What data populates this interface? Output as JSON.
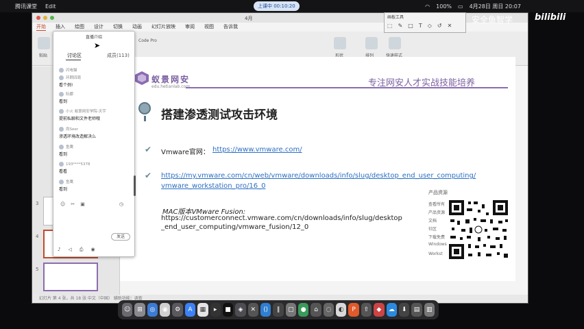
{
  "menubar": {
    "app_name": "腾讯课堂",
    "edit": "Edit",
    "recording": "上课中 00:10:20",
    "time": "4月28日 周日 20:07",
    "battery": "100%"
  },
  "window": {
    "title": "4月",
    "tabs": [
      "开始",
      "插入",
      "绘图",
      "设计",
      "切换",
      "动画",
      "幻灯片放映",
      "审阅",
      "视图",
      "告诉我"
    ],
    "ribbon_labels": [
      "粘贴",
      "新建",
      "排列",
      "快速样式",
      "形状"
    ],
    "font_name": "Code Pro"
  },
  "thumbnails": [
    "3",
    "4",
    "5"
  ],
  "slide": {
    "logo_title": "蚁景网安",
    "logo_url": "edu.hetianlab.com",
    "slogan": "专注网安人才实战技能培养",
    "headline": "搭建渗透测试攻击环境",
    "vmware_label": "Vmware官网：",
    "vmware_link": "https://www.vmware.com/",
    "download_link_1": "https://my.vmware.com/cn/web/vmware/downloads/info/slug/desktop_end_user_computing/",
    "download_link_2": "vmware_workstation_pro/16_0",
    "mac_label": "MAC版本VMware Fusion:",
    "mac_link_1": "https://customerconnect.vmware.com/cn/downloads/info/slug/desktop",
    "mac_link_2": "_end_user_computing/vmware_fusion/12_0",
    "qr_head": "产品资源",
    "qr_side": [
      "查看所有",
      "产品资源",
      "文档",
      "社区",
      "下载免费",
      "Windows",
      "Workst"
    ]
  },
  "statusbar": {
    "text": "幻灯片 第 4 张，共 18 张     中文（中国）    辅助功能：调查"
  },
  "chat": {
    "top_label": "直播介绍",
    "tab_discussion": "讨论区",
    "tab_members": "成员(113)",
    "messages": [
      {
        "user": "闪电猫",
        "body": ""
      },
      {
        "user": "环顾四周",
        "body": "看个例!"
      },
      {
        "user": "阮娜",
        "body": "看到"
      },
      {
        "user": "小火 蚁景网安学院-天宇",
        "body": "提前私聊和文件老师哦"
      },
      {
        "user": "尚Seer",
        "body": "渗透环境改造解决么"
      },
      {
        "user": "鱼鹰",
        "body": "看到"
      },
      {
        "user": "193****5378",
        "body": "看看"
      },
      {
        "user": "鱼鹰",
        "body": "看到"
      }
    ],
    "send": "发送"
  },
  "wbtool": {
    "label": "画板工具"
  },
  "watermark": "安全鱼智学",
  "bilibili": "bilibili"
}
